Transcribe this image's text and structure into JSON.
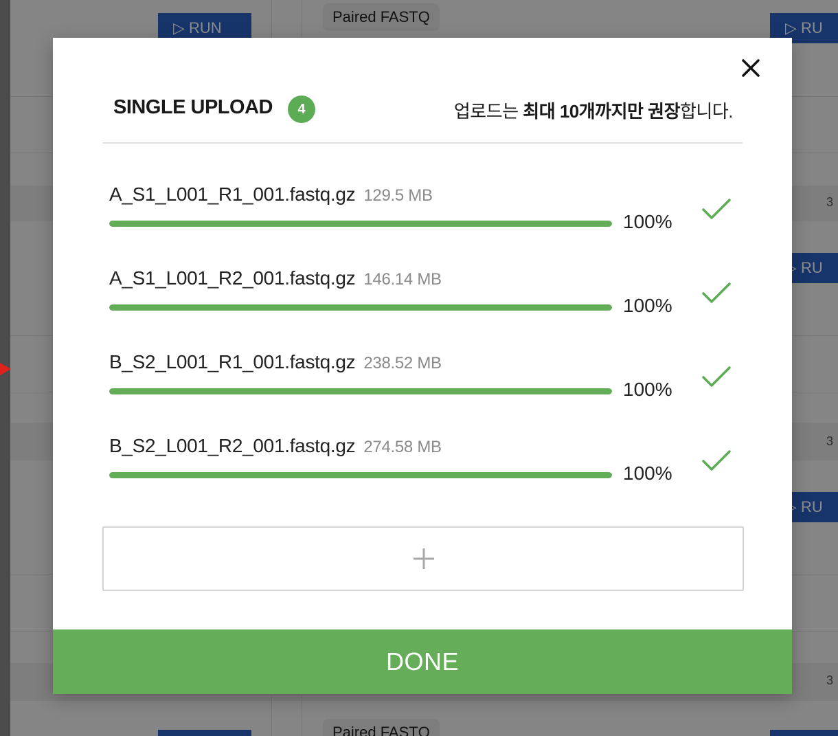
{
  "background": {
    "run_label": "RUN",
    "run_label_partial": "RU",
    "tag_label": "Paired FASTQ",
    "tag_label_bottom": "Paired FASTQ",
    "edge_digit": "3"
  },
  "modal": {
    "title": "SINGLE UPLOAD",
    "count": "4",
    "notice_prefix": "업로드는 ",
    "notice_bold1": "최대 10개까지만 권장",
    "notice_suffix": "합니다.",
    "close_icon": "close-icon",
    "files": [
      {
        "name": "A_S1_L001_R1_001.fastq.gz",
        "size": "129.5 MB",
        "progress": 100,
        "percent_label": "100%",
        "status": "complete"
      },
      {
        "name": "A_S1_L001_R2_001.fastq.gz",
        "size": "146.14 MB",
        "progress": 100,
        "percent_label": "100%",
        "status": "complete"
      },
      {
        "name": "B_S2_L001_R1_001.fastq.gz",
        "size": "238.52 MB",
        "progress": 100,
        "percent_label": "100%",
        "status": "complete"
      },
      {
        "name": "B_S2_L001_R2_001.fastq.gz",
        "size": "274.58 MB",
        "progress": 100,
        "percent_label": "100%",
        "status": "complete"
      }
    ],
    "add_icon": "plus-icon",
    "done_label": "DONE"
  },
  "colors": {
    "accent_green": "#66ad5a",
    "run_blue": "#2b62c4",
    "arrow_red": "#e0211c"
  }
}
